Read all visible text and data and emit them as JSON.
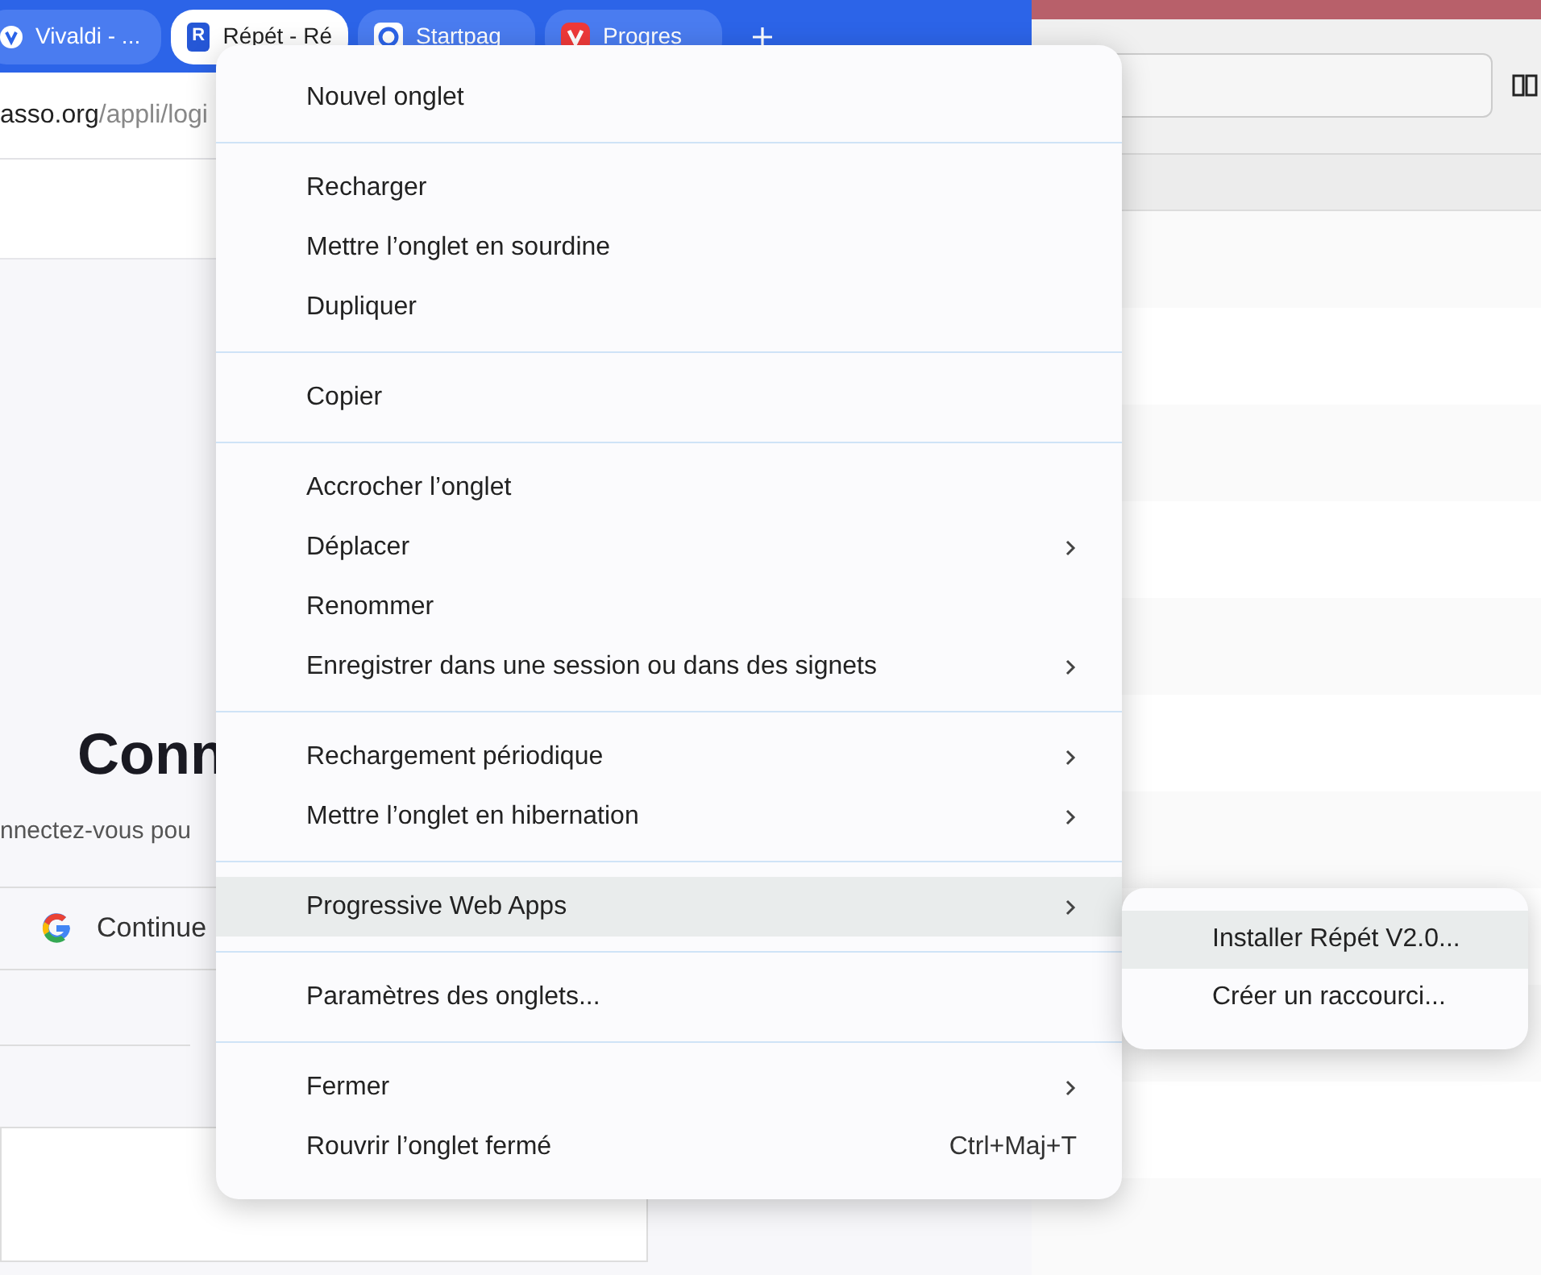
{
  "browser": {
    "tabs": [
      {
        "title": "Vivaldi - ...",
        "selected": false,
        "kind": "vivaldi"
      },
      {
        "title": "Répét - Ré",
        "selected": true,
        "kind": "letter",
        "letter": "R"
      },
      {
        "title": "Startpag",
        "selected": false,
        "kind": "startpage"
      },
      {
        "title": "Progres",
        "selected": false,
        "kind": "vivaldi-red"
      }
    ],
    "address": {
      "host": "asso.org",
      "path": "/appli/logi"
    },
    "page": {
      "heading": "Conn",
      "subtitle": "nnectez-vous pou",
      "google_button": "Continue"
    }
  },
  "context_menu": {
    "sections": [
      [
        {
          "label": "Nouvel onglet",
          "submenu": false,
          "selected": false
        }
      ],
      [
        {
          "label": "Recharger",
          "submenu": false,
          "selected": false
        },
        {
          "label": "Mettre l’onglet en sourdine",
          "submenu": false,
          "selected": false
        },
        {
          "label": "Dupliquer",
          "submenu": false,
          "selected": false
        }
      ],
      [
        {
          "label": "Copier",
          "submenu": false,
          "selected": false
        }
      ],
      [
        {
          "label": "Accrocher l’onglet",
          "submenu": false,
          "selected": false
        },
        {
          "label": "Déplacer",
          "submenu": true,
          "selected": false
        },
        {
          "label": "Renommer",
          "submenu": false,
          "selected": false
        },
        {
          "label": "Enregistrer dans une session ou dans des signets",
          "submenu": true,
          "selected": false
        }
      ],
      [
        {
          "label": "Rechargement périodique",
          "submenu": true,
          "selected": false
        },
        {
          "label": "Mettre l’onglet en hibernation",
          "submenu": true,
          "selected": false
        }
      ],
      [
        {
          "label": "Progressive Web Apps",
          "submenu": true,
          "selected": true
        }
      ],
      [
        {
          "label": "Paramètres des onglets...",
          "submenu": false,
          "selected": false
        }
      ],
      [
        {
          "label": "Fermer",
          "submenu": true,
          "selected": false
        },
        {
          "label": "Rouvrir l’onglet fermé",
          "submenu": false,
          "selected": false,
          "shortcut": "Ctrl+Maj+T"
        }
      ]
    ]
  },
  "submenu": {
    "items": [
      {
        "label": "Installer Répét V2.0...",
        "selected": true
      },
      {
        "label": "Créer un raccourci...",
        "selected": false
      }
    ]
  }
}
